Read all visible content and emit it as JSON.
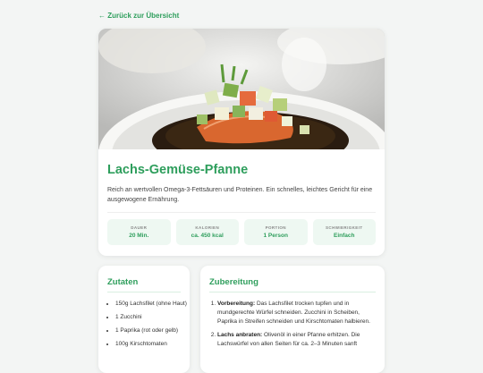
{
  "back_link": {
    "label": "← Zurück zur Übersicht"
  },
  "recipe": {
    "title": "Lachs-Gemüse-Pfanne",
    "description": "Reich an wertvollen Omega-3-Fettsäuren und Proteinen. Ein schnelles, leichtes Gericht für eine ausgewogene Ernährung.",
    "image": "salmon-vegetable-dish-photo",
    "stats": [
      {
        "label": "DAUER",
        "value": "20 Min."
      },
      {
        "label": "KALORIEN",
        "value": "ca. 450 kcal"
      },
      {
        "label": "PORTION",
        "value": "1 Person"
      },
      {
        "label": "SCHWIERIGKEIT",
        "value": "Einfach"
      }
    ]
  },
  "ingredients": {
    "title": "Zutaten",
    "items": [
      "150g Lachsfilet (ohne Haut)",
      "1 Zucchini",
      "1 Paprika (rot oder gelb)",
      "100g Kirschtomaten"
    ]
  },
  "preparation": {
    "title": "Zubereitung",
    "steps": [
      {
        "title": "Vorbereitung:",
        "text": " Das Lachsfilet trocken tupfen und in mundgerechte Würfel schneiden. Zucchini in Scheiben, Paprika in Streifen schneiden und Kirschtomaten halbieren."
      },
      {
        "title": "Lachs anbraten:",
        "text": " Olivenöl in einer Pfanne erhitzen. Die Lachswürfel von allen Seiten für ca. 2–3 Minuten sanft"
      }
    ]
  },
  "colors": {
    "accent": "#2e9e5c",
    "background": "#f3f5f4",
    "stat_bg": "#eef8f2"
  }
}
